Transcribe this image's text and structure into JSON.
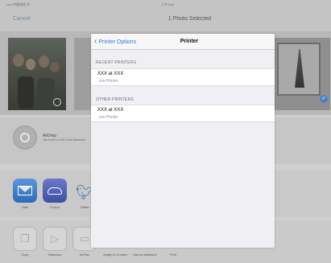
{
  "status_bar": {
    "carrier": "••••• 中国电信 令",
    "time": "上午1:44"
  },
  "nav_bar": {
    "cancel_label": "Cancel",
    "title": "1 Photo Selected"
  },
  "airdrop": {
    "name": "AirDrop",
    "description": "Tap to turn on Wi-Fi and Bluetooth"
  },
  "share_apps": [
    {
      "label": "Mail",
      "icon": "mail-icon"
    },
    {
      "label": "iCloud",
      "icon": "icloud-icon"
    },
    {
      "label": "Twitter",
      "icon": "twitter-icon"
    }
  ],
  "actions": [
    {
      "label": "Copy",
      "icon": "copy-icon"
    },
    {
      "label": "Slideshow",
      "icon": "slideshow-icon"
    },
    {
      "label": "AirPlay",
      "icon": "airplay-icon"
    },
    {
      "label": "Assign to Contact",
      "icon": "contact-icon"
    },
    {
      "label": "Use as Wallpaper",
      "icon": "wallpaper-icon"
    },
    {
      "label": "Print",
      "icon": "print-icon"
    }
  ],
  "popover": {
    "back_label": "Printer Options",
    "title": "Printer",
    "recent_header": "RECENT PRINTERS",
    "recent_printers": [
      {
        "name": "XXX at XXX",
        "subtitle": "xxx Printer"
      }
    ],
    "other_header": "OTHER PRINTERS",
    "other_printers": [
      {
        "name": "XXX at XXX",
        "subtitle": "xxx Printer"
      }
    ]
  },
  "colors": {
    "accent": "#2f7ad8",
    "selected_check": "#4b82c6",
    "popover_bg": "#efeff4"
  }
}
